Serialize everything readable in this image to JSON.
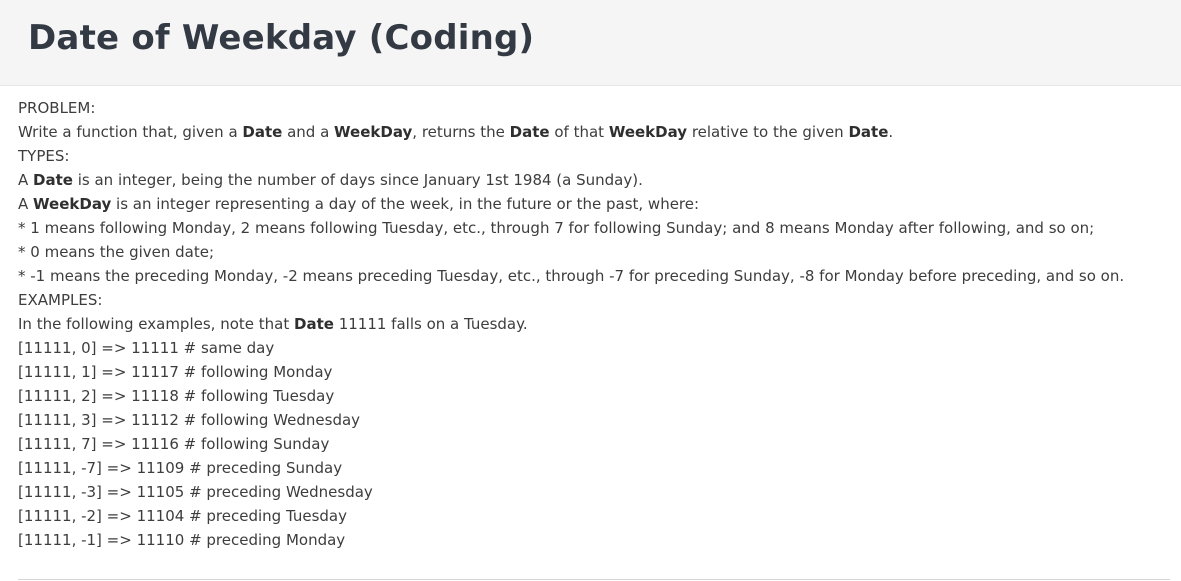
{
  "header": {
    "title": "Date of Weekday (Coding)"
  },
  "problem": {
    "heading": "PROBLEM:",
    "p1": "Write a function that, given a ",
    "b1": "Date",
    "p2": " and a ",
    "b2": "WeekDay",
    "p3": ", returns the ",
    "b3": "Date",
    "p4": " of that ",
    "b4": "WeekDay",
    "p5": " relative to the given ",
    "b5": "Date",
    "p6": "."
  },
  "types": {
    "heading": "TYPES:",
    "date_a": "A ",
    "date_term": "Date",
    "date_desc": " is an integer, being the number of days since January 1st 1984 (a Sunday).",
    "weekday_a": "A ",
    "weekday_term": "WeekDay",
    "weekday_desc": " is an integer representing a day of the week, in the future or the past, where:",
    "bullets": [
      "* 1 means following Monday, 2 means following Tuesday, etc., through 7 for following Sunday; and 8 means Monday after following, and so on;",
      "* 0 means the given date;",
      "* -1 means the preceding Monday, -2 means preceding Tuesday, etc., through -7 for preceding Sunday, -8 for Monday before preceding, and so on."
    ]
  },
  "examples": {
    "heading": "EXAMPLES:",
    "intro_pre": "In the following examples, note that ",
    "intro_term": "Date",
    "intro_post": " 11111 falls on a Tuesday.",
    "lines": [
      "[11111, 0] => 11111  # same day",
      "[11111, 1] => 11117  # following Monday",
      "[11111, 2] => 11118  # following Tuesday",
      "[11111, 3] => 11112  # following Wednesday",
      "[11111, 7] => 11116  # following Sunday",
      "[11111, -7] => 11109 # preceding Sunday",
      "[11111, -3] => 11105 # preceding Wednesday",
      "[11111, -2] => 11104 # preceding Tuesday",
      "[11111, -1] => 11110 # preceding Monday"
    ]
  }
}
